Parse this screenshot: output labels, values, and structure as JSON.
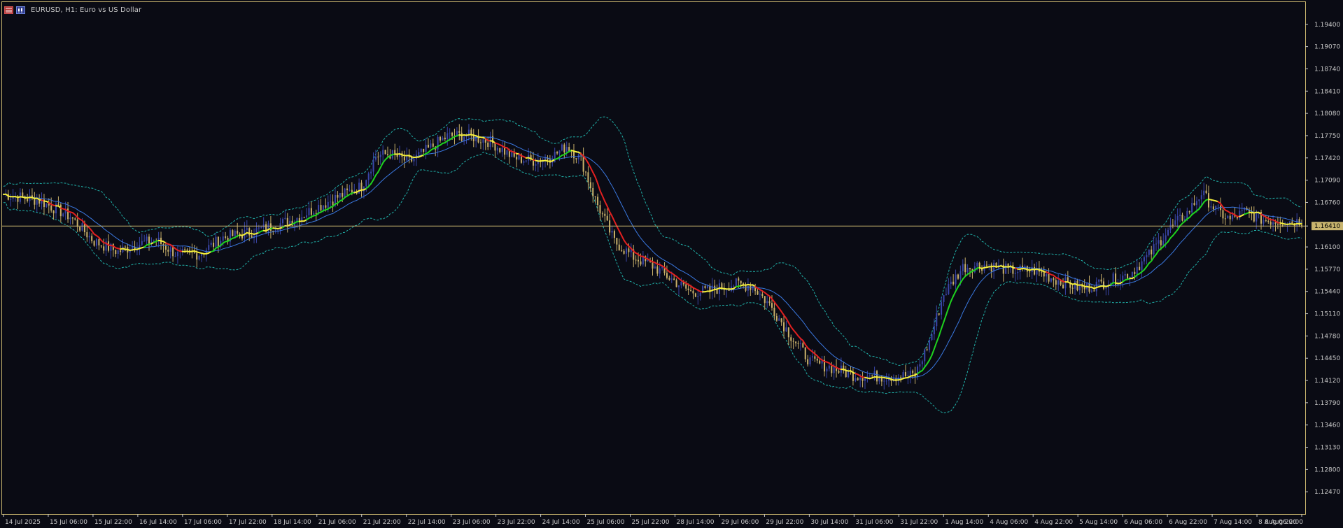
{
  "window": {
    "symbol_title": "EURUSD, H1:  Euro vs US Dollar",
    "icons": [
      "grid-icon",
      "candlestick-icon"
    ]
  },
  "colors": {
    "background": "#0a0b14",
    "frame": "#c8b46e",
    "bull_candle": "#3a46a8",
    "bear_candle": "#c8b06a",
    "ma_up": "#1fd21f",
    "ma_down": "#e02020",
    "ma_flat": "#f5ef3a",
    "ma_slow": "#3a78e0",
    "bands": "#20b2aa",
    "price_line": "#c8b46e"
  },
  "chart_data": {
    "type": "candlestick",
    "timeframe": "H1",
    "y_ticks": [
      "1.19400",
      "1.19070",
      "1.18740",
      "1.18410",
      "1.18080",
      "1.17750",
      "1.17420",
      "1.17090",
      "1.16760",
      "1.16410",
      "1.16100",
      "1.15770",
      "1.15440",
      "1.15110",
      "1.14780",
      "1.14450",
      "1.14120",
      "1.13790",
      "1.13460",
      "1.13130",
      "1.12800",
      "1.12470"
    ],
    "ylim": [
      1.1214,
      1.1973
    ],
    "current_price": "1.16410",
    "current_price_value": 1.1641,
    "x_ticks": [
      "14 Jul 2025",
      "15 Jul 06:00",
      "15 Jul 22:00",
      "16 Jul 14:00",
      "17 Jul 06:00",
      "17 Jul 22:00",
      "18 Jul 14:00",
      "21 Jul 06:00",
      "21 Jul 22:00",
      "22 Jul 14:00",
      "23 Jul 06:00",
      "23 Jul 22:00",
      "24 Jul 14:00",
      "25 Jul 06:00",
      "25 Jul 22:00",
      "28 Jul 14:00",
      "29 Jul 06:00",
      "29 Jul 22:00",
      "30 Jul 14:00",
      "31 Jul 06:00",
      "31 Jul 22:00",
      "1 Aug 14:00",
      "4 Aug 06:00",
      "4 Aug 22:00",
      "5 Aug 14:00",
      "6 Aug 06:00",
      "6 Aug 22:00",
      "7 Aug 14:00",
      "8 Aug 06:00",
      "8 Aug 22:00"
    ],
    "close_path": [
      [
        0,
        1.1688
      ],
      [
        15,
        1.1679
      ],
      [
        28,
        1.1655
      ],
      [
        38,
        1.1618
      ],
      [
        48,
        1.1603
      ],
      [
        56,
        1.1614
      ],
      [
        64,
        1.162
      ],
      [
        73,
        1.1598
      ],
      [
        82,
        1.16
      ],
      [
        92,
        1.1624
      ],
      [
        104,
        1.1632
      ],
      [
        112,
        1.164
      ],
      [
        122,
        1.1651
      ],
      [
        132,
        1.167
      ],
      [
        140,
        1.1684
      ],
      [
        150,
        1.17
      ],
      [
        156,
        1.1745
      ],
      [
        162,
        1.1748
      ],
      [
        170,
        1.1736
      ],
      [
        178,
        1.1755
      ],
      [
        186,
        1.1774
      ],
      [
        194,
        1.1776
      ],
      [
        204,
        1.1766
      ],
      [
        214,
        1.1742
      ],
      [
        222,
        1.1738
      ],
      [
        230,
        1.1744
      ],
      [
        236,
        1.176
      ],
      [
        242,
        1.174
      ],
      [
        248,
        1.168
      ],
      [
        256,
        1.1618
      ],
      [
        264,
        1.1595
      ],
      [
        272,
        1.1582
      ],
      [
        280,
        1.1562
      ],
      [
        288,
        1.1543
      ],
      [
        296,
        1.1545
      ],
      [
        306,
        1.1555
      ],
      [
        314,
        1.1552
      ],
      [
        322,
        1.152
      ],
      [
        330,
        1.1478
      ],
      [
        338,
        1.144
      ],
      [
        346,
        1.1432
      ],
      [
        356,
        1.142
      ],
      [
        366,
        1.1418
      ],
      [
        374,
        1.1418
      ],
      [
        382,
        1.142
      ],
      [
        388,
        1.147
      ],
      [
        394,
        1.154
      ],
      [
        402,
        1.158
      ],
      [
        412,
        1.1584
      ],
      [
        422,
        1.1575
      ],
      [
        432,
        1.1575
      ],
      [
        442,
        1.156
      ],
      [
        452,
        1.1548
      ],
      [
        462,
        1.1558
      ],
      [
        472,
        1.157
      ],
      [
        480,
        1.1598
      ],
      [
        488,
        1.1635
      ],
      [
        496,
        1.166
      ],
      [
        502,
        1.169
      ],
      [
        508,
        1.1665
      ],
      [
        514,
        1.165
      ],
      [
        520,
        1.1662
      ],
      [
        528,
        1.165
      ],
      [
        536,
        1.1648
      ],
      [
        544,
        1.1648
      ]
    ]
  }
}
